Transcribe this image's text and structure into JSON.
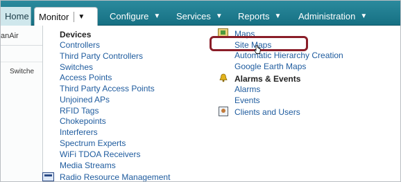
{
  "nav": {
    "home": "Home",
    "monitor": "Monitor",
    "configure": "Configure",
    "services": "Services",
    "reports": "Reports",
    "administration": "Administration",
    "arrow_glyph": "▼"
  },
  "background": {
    "left_fragment": "anAir",
    "switches_fragment": "Switche"
  },
  "menu": {
    "devices_heading": "Devices",
    "devices": [
      "Controllers",
      "Third Party Controllers",
      "Switches",
      "Access Points",
      "Third Party Access Points",
      "Unjoined APs",
      "RFID Tags",
      "Chokepoints",
      "Interferers",
      "Spectrum Experts",
      "WiFi TDOA Receivers",
      "Media Streams"
    ],
    "radio_resource_management": "Radio Resource Management",
    "maps": "Maps",
    "maps_items": [
      "Site Maps",
      "Automatic Hierarchy Creation",
      "Google Earth Maps"
    ],
    "alarms_heading": "Alarms & Events",
    "alarms_items": [
      "Alarms",
      "Events"
    ],
    "clients_and_users": "Clients and Users"
  },
  "colors": {
    "nav_bar": "#167083",
    "link": "#1e5b9e",
    "highlight_box": "#8a1d28"
  },
  "icons": {
    "rrm": "radio-resource-icon",
    "maps": "map-icon",
    "alarms": "bell-icon",
    "clients": "clients-icon",
    "pointer": "hand-cursor-icon"
  }
}
